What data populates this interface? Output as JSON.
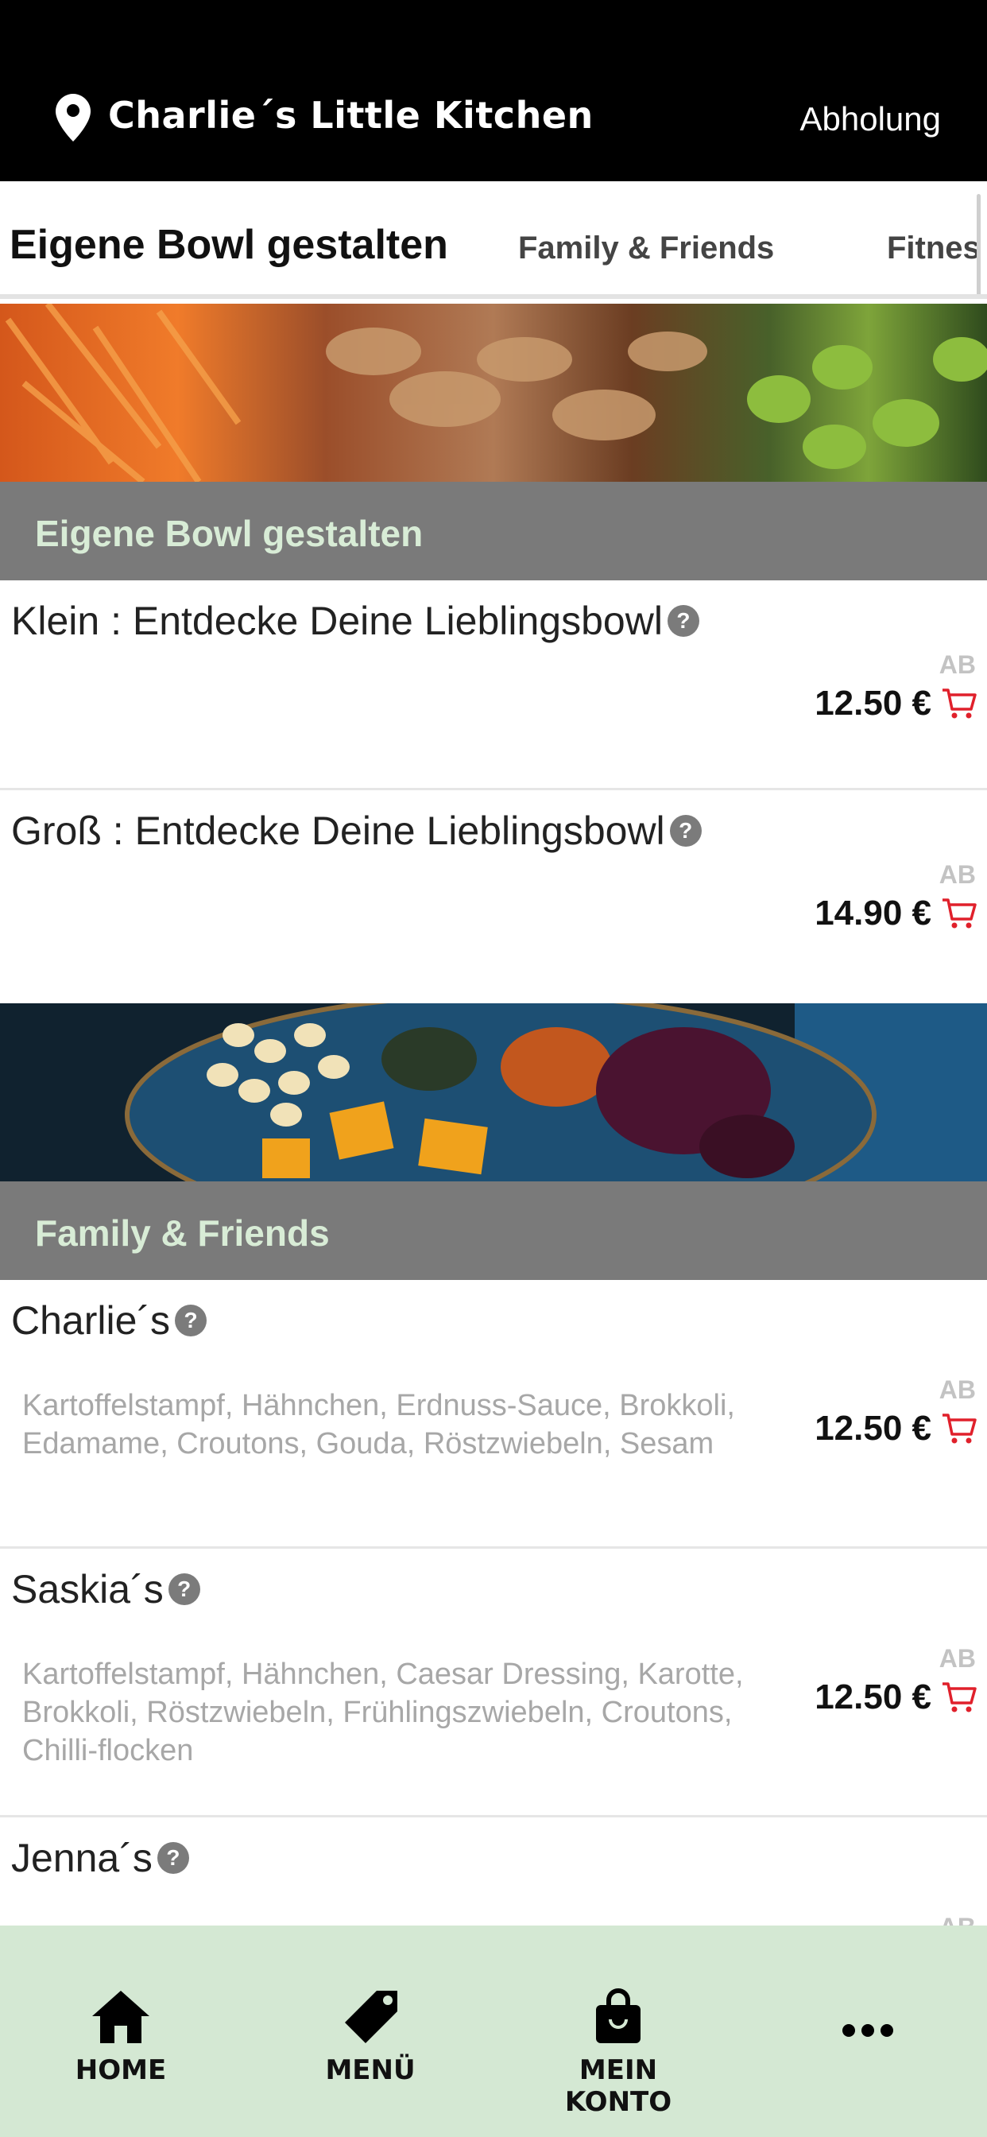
{
  "header": {
    "location_icon": "map-pin-icon",
    "restaurant_name": "Charlie´s Little Kitchen",
    "mode": "Abholung"
  },
  "tabs": [
    {
      "label": "Eigene Bowl gestalten",
      "active": true
    },
    {
      "label": "Family & Friends",
      "active": false
    },
    {
      "label": "Fitnes",
      "active": false
    }
  ],
  "sections": [
    {
      "title": "Eigene Bowl gestalten",
      "items": [
        {
          "name": "Klein : Entdecke Deine Lieblingsbowl",
          "prefix": "AB",
          "price": "12.50 €",
          "description": ""
        },
        {
          "name": "Groß : Entdecke Deine Lieblingsbowl",
          "prefix": "AB",
          "price": "14.90 €",
          "description": ""
        }
      ]
    },
    {
      "title": "Family & Friends",
      "items": [
        {
          "name": "Charlie´s",
          "prefix": "AB",
          "price": "12.50 €",
          "description": "Kartoffelstampf, Hähnchen, Erdnuss-Sauce, Brokkoli, Edamame, Croutons, Gouda, Röstzwiebeln, Sesam"
        },
        {
          "name": "Saskia´s",
          "prefix": "AB",
          "price": "12.50 €",
          "description": "Kartoffelstampf, Hähnchen, Caesar Dressing, Karotte, Brokkoli, Röstzwiebeln, Frühlingszwiebeln, Croutons, Chilli-flocken"
        },
        {
          "name": "Jenna´s",
          "prefix": "AB",
          "price": "",
          "description": ""
        }
      ]
    }
  ],
  "help_symbol": "?",
  "bottom_nav": [
    {
      "label": "HOME",
      "icon": "home-icon"
    },
    {
      "label": "MENÜ",
      "icon": "tag-icon"
    },
    {
      "label": "MEIN KONTO",
      "icon": "shopping-bag-icon"
    },
    {
      "label": "",
      "icon": "more-dots-icon"
    }
  ],
  "colors": {
    "header_bg": "#000000",
    "section_bg": "#7a7a7a",
    "section_text": "#d8ecd6",
    "cart_icon": "#e0202b",
    "bottom_nav_bg": "#d4e8d3"
  }
}
